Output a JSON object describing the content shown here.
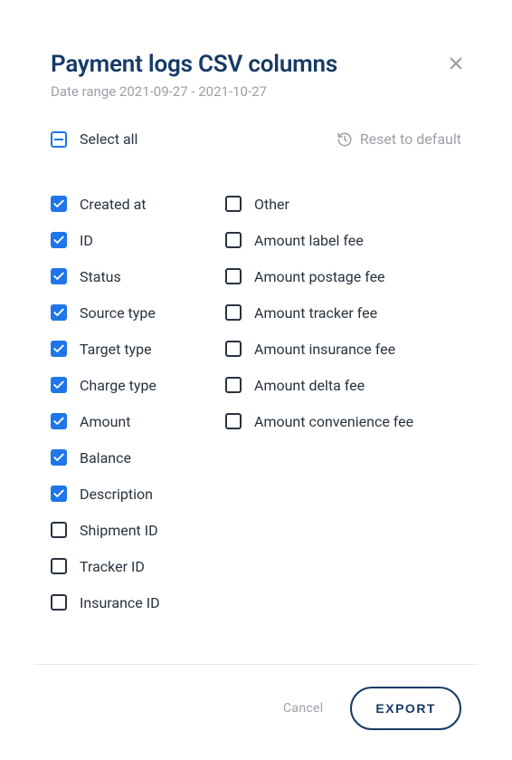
{
  "header": {
    "title": "Payment logs CSV columns",
    "subtitle": "Date range 2021-09-27 - 2021-10-27"
  },
  "controls": {
    "select_all_label": "Select all",
    "reset_label": "Reset to default"
  },
  "columns_left": [
    {
      "label": "Created at",
      "checked": true
    },
    {
      "label": "ID",
      "checked": true
    },
    {
      "label": "Status",
      "checked": true
    },
    {
      "label": "Source type",
      "checked": true
    },
    {
      "label": "Target type",
      "checked": true
    },
    {
      "label": "Charge type",
      "checked": true
    },
    {
      "label": "Amount",
      "checked": true
    },
    {
      "label": "Balance",
      "checked": true
    },
    {
      "label": "Description",
      "checked": true
    },
    {
      "label": "Shipment ID",
      "checked": false
    },
    {
      "label": "Tracker ID",
      "checked": false
    },
    {
      "label": "Insurance ID",
      "checked": false
    }
  ],
  "columns_right": [
    {
      "label": "Other",
      "checked": false
    },
    {
      "label": "Amount label fee",
      "checked": false
    },
    {
      "label": "Amount postage fee",
      "checked": false
    },
    {
      "label": "Amount tracker fee",
      "checked": false
    },
    {
      "label": "Amount insurance fee",
      "checked": false
    },
    {
      "label": "Amount delta fee",
      "checked": false
    },
    {
      "label": "Amount convenience fee",
      "checked": false
    }
  ],
  "footer": {
    "cancel_label": "Cancel",
    "export_label": "EXPORT"
  }
}
